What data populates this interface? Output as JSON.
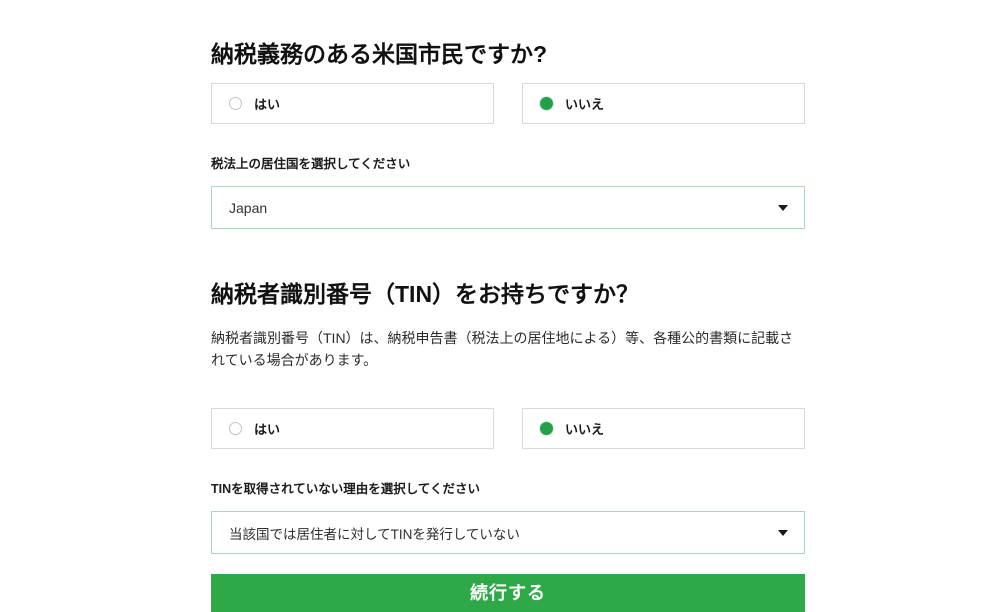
{
  "form": {
    "us_citizen_question": {
      "heading": "納税義務のある米国市民ですか?",
      "options": [
        {
          "label": "はい",
          "selected": false,
          "marker": "radio-unselected-icon"
        },
        {
          "label": "いいえ",
          "selected": true,
          "marker": "radio-selected-icon"
        }
      ]
    },
    "tax_residence": {
      "label": "税法上の居住国を選択してください",
      "value": "Japan",
      "dropdown_icon": "chevron-down-icon"
    },
    "tin_question": {
      "heading": "納税者識別番号（TIN）をお持ちですか？",
      "description": "納税者識別番号（TIN）は、納税申告書（税法上の居住地による）等、各種公的書類に記載されている場合があります。",
      "options": [
        {
          "label": "はい",
          "selected": false,
          "marker": "radio-unselected-icon"
        },
        {
          "label": "いいえ",
          "selected": true,
          "marker": "radio-selected-icon"
        }
      ]
    },
    "tin_reason": {
      "label": "TINを取得されていない理由を選択してください",
      "value": "当該国では居住者に対してTINを発行していない",
      "dropdown_icon": "chevron-down-icon"
    },
    "submit": {
      "label": "続行する"
    }
  },
  "colors": {
    "page_background": "#ffffff",
    "accent_green": "#2fa848",
    "radio_selected_green": "#22a04a",
    "select_border_green": "#a9d9b5",
    "option_border_gray": "#d9d9d9",
    "heading_text": "#111111",
    "body_text": "#2b2b2b",
    "button_text": "#ffffff"
  }
}
